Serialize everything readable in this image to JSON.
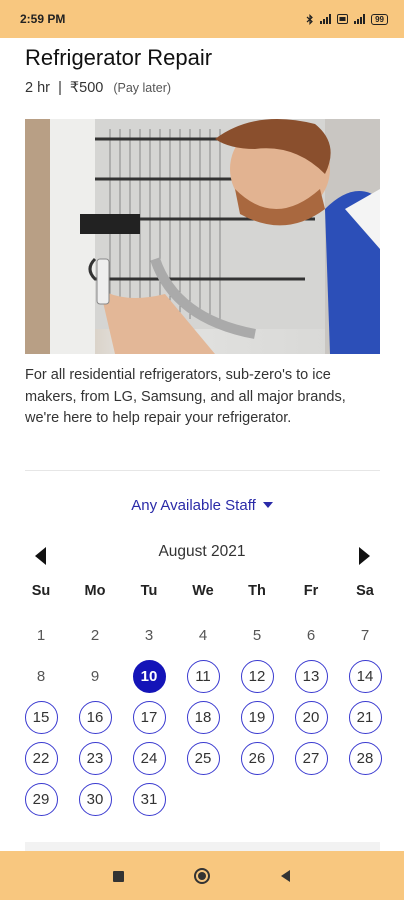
{
  "status_bar": {
    "time": "2:59 PM",
    "icons": [
      "bluetooth-icon",
      "signal-icon",
      "hd-icon",
      "signal-icon",
      "battery-icon"
    ],
    "battery": "99",
    "color": "#f8c77f"
  },
  "service": {
    "title": "Refrigerator Repair",
    "duration": "2 hr",
    "separator": "|",
    "price": "₹500",
    "payment_note": "(Pay later)",
    "description": "For all residential refrigerators, sub-zero's to ice makers, from LG, Samsung, and all major brands, we're here to help repair your refrigerator."
  },
  "staff_selector": {
    "label": "Any Available Staff",
    "color": "#2a2aa8"
  },
  "calendar": {
    "month_label": "August 2021",
    "weekdays": [
      "Su",
      "Mo",
      "Tu",
      "We",
      "Th",
      "Fr",
      "Sa"
    ],
    "days": [
      {
        "label": "1",
        "state": "disabled"
      },
      {
        "label": "2",
        "state": "disabled"
      },
      {
        "label": "3",
        "state": "disabled"
      },
      {
        "label": "4",
        "state": "disabled"
      },
      {
        "label": "5",
        "state": "disabled"
      },
      {
        "label": "6",
        "state": "disabled"
      },
      {
        "label": "7",
        "state": "disabled"
      },
      {
        "label": "8",
        "state": "disabled"
      },
      {
        "label": "9",
        "state": "disabled"
      },
      {
        "label": "10",
        "state": "selected"
      },
      {
        "label": "11",
        "state": "available"
      },
      {
        "label": "12",
        "state": "available"
      },
      {
        "label": "13",
        "state": "available"
      },
      {
        "label": "14",
        "state": "available"
      },
      {
        "label": "15",
        "state": "available"
      },
      {
        "label": "16",
        "state": "available"
      },
      {
        "label": "17",
        "state": "available"
      },
      {
        "label": "18",
        "state": "available"
      },
      {
        "label": "19",
        "state": "available"
      },
      {
        "label": "20",
        "state": "available"
      },
      {
        "label": "21",
        "state": "available"
      },
      {
        "label": "22",
        "state": "available"
      },
      {
        "label": "23",
        "state": "available"
      },
      {
        "label": "24",
        "state": "available"
      },
      {
        "label": "25",
        "state": "available"
      },
      {
        "label": "26",
        "state": "available"
      },
      {
        "label": "27",
        "state": "available"
      },
      {
        "label": "28",
        "state": "available"
      },
      {
        "label": "29",
        "state": "available"
      },
      {
        "label": "30",
        "state": "available"
      },
      {
        "label": "31",
        "state": "available"
      }
    ],
    "selected_color": "#1414b8",
    "available_border_color": "#3a3ad0"
  },
  "nav_bar": {
    "buttons": [
      "recents-square-icon",
      "home-circle-icon",
      "back-triangle-icon"
    ],
    "color": "#f8c77f"
  }
}
